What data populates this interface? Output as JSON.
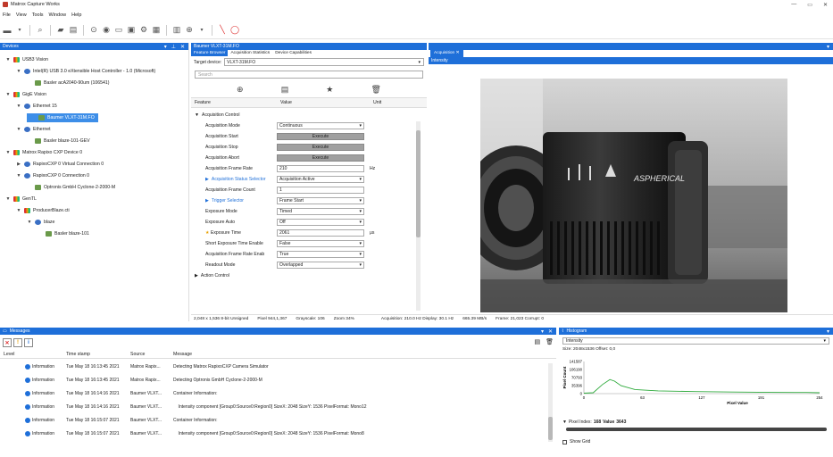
{
  "window": {
    "title": "Matrox Capture Works",
    "controls": [
      "—",
      "▭",
      "✕"
    ]
  },
  "menu": [
    "File",
    "View",
    "Tools",
    "Window",
    "Help"
  ],
  "devices": {
    "title": "Devices",
    "items": [
      {
        "label": "USB3 Vision",
        "arrow": "▼",
        "level": 0,
        "icon": "grid"
      },
      {
        "label": "Intel(R) USB 3.0 eXtensible Host Controller - 1.0 (Microsoft)",
        "arrow": "▼",
        "level": 1,
        "icon": "net"
      },
      {
        "label": "Basler acA2040-90um (106541)",
        "arrow": "",
        "level": 2,
        "icon": "cam"
      },
      {
        "label": "GigE Vision",
        "arrow": "▼",
        "level": 0,
        "icon": "grid"
      },
      {
        "label": "Ethernet 15",
        "arrow": "▼",
        "level": 1,
        "icon": "net"
      },
      {
        "label": "Baumer VLXT-31M.FO",
        "arrow": "",
        "level": 2,
        "icon": "cam",
        "selected": true
      },
      {
        "label": "Ethernet",
        "arrow": "▼",
        "level": 1,
        "icon": "net"
      },
      {
        "label": "Basler blaze-101-GEV",
        "arrow": "",
        "level": 2,
        "icon": "cam"
      },
      {
        "label": "Matrox Rapixo CXP Device 0",
        "arrow": "▼",
        "level": 0,
        "icon": "grid"
      },
      {
        "label": "RapixoCXP 0 Virtual Connection 0",
        "arrow": "▶",
        "level": 1,
        "icon": "net"
      },
      {
        "label": "RapixoCXP 0 Connection 0",
        "arrow": "▼",
        "level": 1,
        "icon": "net"
      },
      {
        "label": "Optronis GmbH Cyclone-2-2000-M",
        "arrow": "",
        "level": 2,
        "icon": "cam"
      },
      {
        "label": "GenTL",
        "arrow": "▼",
        "level": 0,
        "icon": "grid"
      },
      {
        "label": "ProducerBlaze.cti",
        "arrow": "▼",
        "level": 1,
        "icon": "grid"
      },
      {
        "label": "blaze",
        "arrow": "▼",
        "level": 2,
        "icon": "net"
      },
      {
        "label": "Basler blaze-101",
        "arrow": "",
        "level": 3,
        "icon": "cam"
      }
    ]
  },
  "feature": {
    "header": "Baumer VLXT-31M.FO",
    "tabs": [
      "Feature Browser",
      "Acquisition Statistics",
      "Device Capabilities"
    ],
    "target_label": "Target device:",
    "target_value": "VLXT-31M.FO",
    "search_placeholder": "Search",
    "col_feature": "Feature",
    "col_value": "Value",
    "col_unit": "Unit",
    "rows": [
      {
        "name": "Acquisition Control",
        "value": "",
        "kind": "group",
        "arrow": "▼"
      },
      {
        "name": "Acquisition Mode",
        "value": "Continuous",
        "kind": "select"
      },
      {
        "name": "Acquisition Start",
        "value": "Execute",
        "kind": "button"
      },
      {
        "name": "Acquisition Stop",
        "value": "Execute",
        "kind": "button"
      },
      {
        "name": "Acquisition Abort",
        "value": "Execute",
        "kind": "button"
      },
      {
        "name": "Acquisition Frame Rate",
        "value": "210",
        "kind": "text",
        "unit": "Hz"
      },
      {
        "name": "Acquisition Status Selector",
        "value": "Acquisition Active",
        "kind": "select",
        "link": true,
        "arrow": "▶"
      },
      {
        "name": "Acquisition Frame Count",
        "value": "1",
        "kind": "text"
      },
      {
        "name": "Trigger Selector",
        "value": "Frame Start",
        "kind": "select",
        "link": true,
        "arrow": "▶"
      },
      {
        "name": "Exposure Mode",
        "value": "Timed",
        "kind": "select"
      },
      {
        "name": "Exposure Auto",
        "value": "Off",
        "kind": "select"
      },
      {
        "name": "Exposure Time",
        "value": "2061",
        "kind": "text",
        "unit": "μs",
        "star": true
      },
      {
        "name": "Short Exposure Time Enable",
        "value": "False",
        "kind": "select"
      },
      {
        "name": "Acquisition Frame Rate Enab",
        "value": "True",
        "kind": "select"
      },
      {
        "name": "Readout Mode",
        "value": "Overlapped",
        "kind": "select"
      },
      {
        "name": "Action Control",
        "value": "",
        "kind": "group",
        "arrow": "▶"
      }
    ]
  },
  "acquisition": {
    "tab": "Acquisition",
    "tab_close": "✕",
    "bar": "Intensity",
    "lens_text": "ASPHERICAL"
  },
  "status": {
    "image": "2,048 x 1,536 8-bit Unsigned",
    "pixel": "Pixel 944,1,367",
    "gray": "Grayscale: 106",
    "zoom": "Zoom 34%",
    "acq": "Acquisition: 210.0 Hz Display: 30.1 Hz",
    "rate": "665.39 MB/s",
    "frame": "Frame: 21,023 Corrupt: 0"
  },
  "messages": {
    "title": "Messages",
    "cols": [
      "Level",
      "Time stamp",
      "Source",
      "Message"
    ],
    "rows": [
      {
        "level": "Information",
        "time": "Tue May 18 16:13:45 2021",
        "source": "Matrox Rapix...",
        "msg": "Detecting Matrox RapixoCXP Camera Simulator"
      },
      {
        "level": "Information",
        "time": "Tue May 18 16:13:45 2021",
        "source": "Matrox Rapix...",
        "msg": "Detecting Optronis GmbH Cyclone-2-2000-M"
      },
      {
        "level": "Information",
        "time": "Tue May 18 16:14:16 2021",
        "source": "Baumer VLXT...",
        "msg": "Container Information:"
      },
      {
        "level": "Information",
        "time": "Tue May 18 16:14:16 2021",
        "source": "Baumer VLXT...",
        "msg": "    Intensity component [Group0:Source0:Region0] SizeX: 2048 SizeY: 1536 PixelFormat: Mono12"
      },
      {
        "level": "Information",
        "time": "Tue May 18 16:15:07 2021",
        "source": "Baumer VLXT...",
        "msg": "Container Information:"
      },
      {
        "level": "Information",
        "time": "Tue May 18 16:15:07 2021",
        "source": "Baumer VLXT...",
        "msg": "    Intensity component [Group0:Source0:Region0] SizeX: 2048 SizeY: 1536 PixelFormat: Mono8"
      }
    ]
  },
  "histogram": {
    "title": "Histogram",
    "select": "Intensity",
    "size": "Size: 2048x1536  Offset: 0,0",
    "yticks": [
      "141587",
      "106190",
      "70793",
      "35396",
      "0"
    ],
    "xticks": [
      "0",
      "63",
      "127",
      "191",
      "254"
    ],
    "ylabel": "Pixel Count",
    "xlabel": "Pixel Value",
    "pixel_index_label": "Pixel Index:",
    "pixel_index": "168",
    "value_label": "Value",
    "value": "3643",
    "show_grid": "Show Grid",
    "curve": [
      [
        0,
        2000
      ],
      [
        10,
        4000
      ],
      [
        20,
        40000
      ],
      [
        28,
        62000
      ],
      [
        33,
        55000
      ],
      [
        40,
        35000
      ],
      [
        55,
        18000
      ],
      [
        80,
        12000
      ],
      [
        120,
        9000
      ],
      [
        160,
        7000
      ],
      [
        200,
        5500
      ],
      [
        240,
        5000
      ],
      [
        254,
        4000
      ]
    ],
    "ymax": 141587
  }
}
